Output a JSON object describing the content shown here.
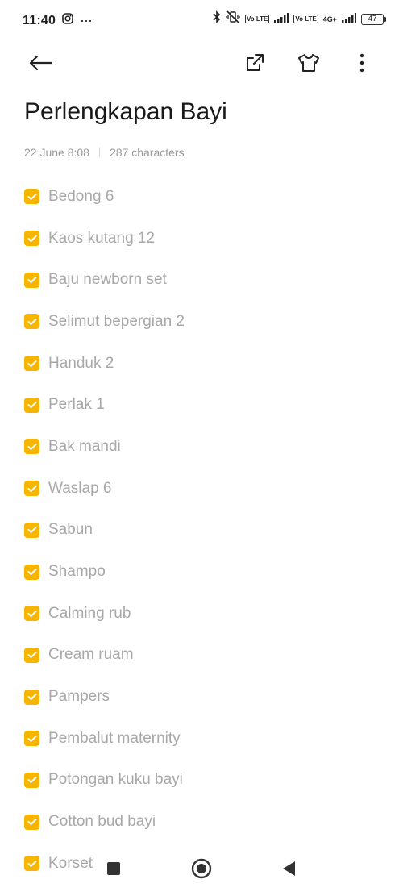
{
  "status_bar": {
    "time": "11:40",
    "more": "···",
    "volte1": "Vo LTE",
    "volte2": "Vo LTE",
    "network": "4G+",
    "battery": "47"
  },
  "note": {
    "title": "Perlengkapan Bayi",
    "date": "22 June 8:08",
    "char_count": "287 characters"
  },
  "checklist": [
    {
      "label": "Bedong 6",
      "checked": true
    },
    {
      "label": "Kaos kutang 12",
      "checked": true
    },
    {
      "label": "Baju newborn set",
      "checked": true
    },
    {
      "label": "Selimut bepergian 2",
      "checked": true
    },
    {
      "label": "Handuk 2",
      "checked": true
    },
    {
      "label": "Perlak 1",
      "checked": true
    },
    {
      "label": "Bak mandi",
      "checked": true
    },
    {
      "label": "Waslap 6",
      "checked": true
    },
    {
      "label": "Sabun",
      "checked": true
    },
    {
      "label": "Shampo",
      "checked": true
    },
    {
      "label": "Calming rub",
      "checked": true
    },
    {
      "label": "Cream ruam",
      "checked": true
    },
    {
      "label": "Pampers",
      "checked": true
    },
    {
      "label": "Pembalut maternity",
      "checked": true
    },
    {
      "label": "Potongan kuku bayi",
      "checked": true
    },
    {
      "label": "Cotton bud bayi",
      "checked": true
    },
    {
      "label": "Korset",
      "checked": true
    }
  ],
  "colors": {
    "accent": "#f7b500",
    "item_text": "#a8a8a8",
    "meta_text": "#9a9a9a"
  },
  "icons": {
    "back": "arrow-left-icon",
    "share": "share-external-icon",
    "theme": "tshirt-icon",
    "menu": "more-vertical-icon",
    "nav_recents": "square-icon",
    "nav_home": "circle-home-icon",
    "nav_back": "triangle-back-icon"
  }
}
